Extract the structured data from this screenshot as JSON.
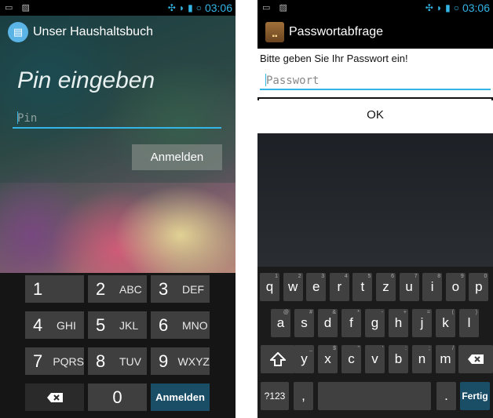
{
  "status_bar": {
    "time": "03:06"
  },
  "left_screen": {
    "app_title": "Unser Haushaltsbuch",
    "heading": "Pin eingeben",
    "pin_placeholder": "Pin",
    "login_button": "Anmelden",
    "numpad": [
      {
        "num": "1",
        "letters": ""
      },
      {
        "num": "2",
        "letters": "ABC"
      },
      {
        "num": "3",
        "letters": "DEF"
      },
      {
        "num": "4",
        "letters": "GHI"
      },
      {
        "num": "5",
        "letters": "JKL"
      },
      {
        "num": "6",
        "letters": "MNO"
      },
      {
        "num": "7",
        "letters": "PQRS"
      },
      {
        "num": "8",
        "letters": "TUV"
      },
      {
        "num": "9",
        "letters": "WXYZ"
      }
    ],
    "numpad_zero": "0",
    "numpad_enter": "Anmelden"
  },
  "right_screen": {
    "app_title": "Passwortabfrage",
    "prompt": "Bitte geben Sie Ihr Passwort ein!",
    "password_placeholder": "Passwort",
    "ok_button": "OK",
    "keyboard": {
      "row1": [
        {
          "k": "q",
          "s": "1"
        },
        {
          "k": "w",
          "s": "2"
        },
        {
          "k": "e",
          "s": "3"
        },
        {
          "k": "r",
          "s": "4"
        },
        {
          "k": "t",
          "s": "5"
        },
        {
          "k": "z",
          "s": "6"
        },
        {
          "k": "u",
          "s": "7"
        },
        {
          "k": "i",
          "s": "8"
        },
        {
          "k": "o",
          "s": "9"
        },
        {
          "k": "p",
          "s": "0"
        }
      ],
      "row2": [
        {
          "k": "a",
          "s": "@"
        },
        {
          "k": "s",
          "s": "#"
        },
        {
          "k": "d",
          "s": "&"
        },
        {
          "k": "f",
          "s": "*"
        },
        {
          "k": "g",
          "s": "-"
        },
        {
          "k": "h",
          "s": "+"
        },
        {
          "k": "j",
          "s": "="
        },
        {
          "k": "k",
          "s": "("
        },
        {
          "k": "l",
          "s": ")"
        }
      ],
      "row3": [
        {
          "k": "y",
          "s": "_"
        },
        {
          "k": "x",
          "s": "$"
        },
        {
          "k": "c",
          "s": "\""
        },
        {
          "k": "v",
          "s": "'"
        },
        {
          "k": "b",
          "s": ":"
        },
        {
          "k": "n",
          "s": ";"
        },
        {
          "k": "m",
          "s": "/"
        }
      ],
      "symbols_key": "?123",
      "comma_key": ",",
      "period_key": ".",
      "done_key": "Fertig"
    }
  },
  "colors": {
    "accent": "#33b5e5",
    "action_key": "#1a4d66"
  }
}
